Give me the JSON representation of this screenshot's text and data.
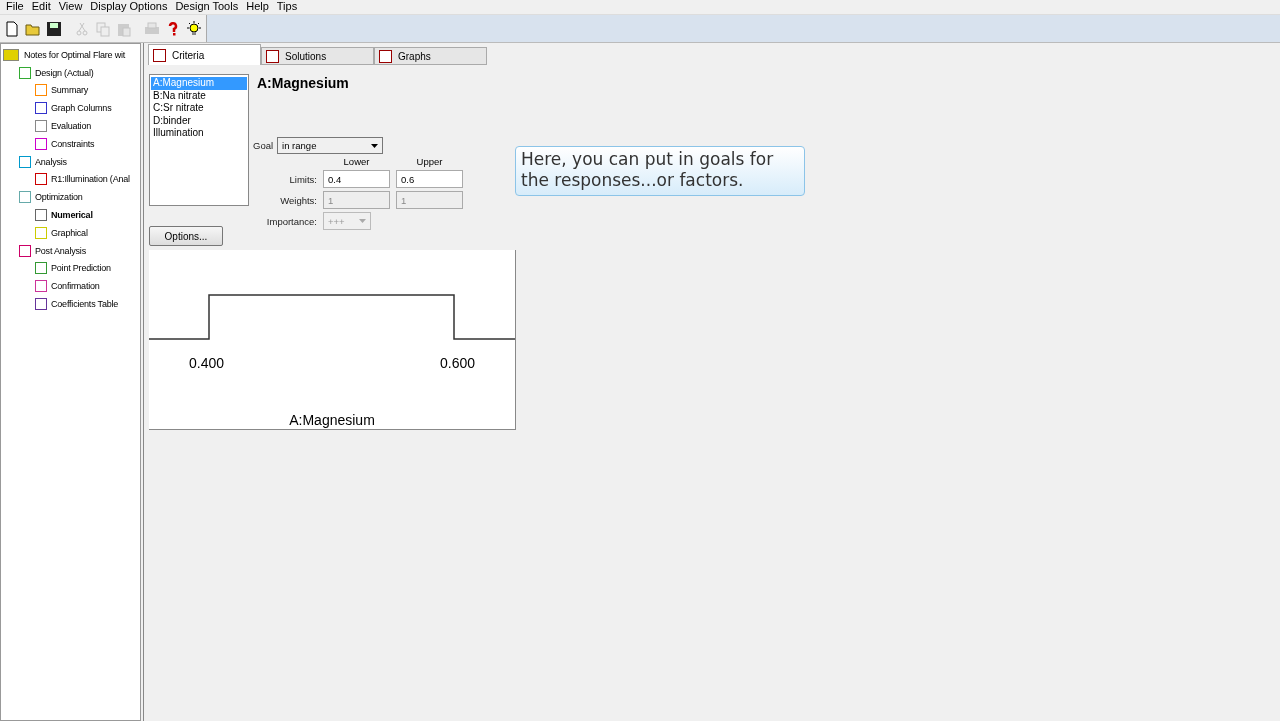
{
  "menu": [
    "File",
    "Edit",
    "View",
    "Display Options",
    "Design Tools",
    "Help",
    "Tips"
  ],
  "toolbar": [
    {
      "kind": "new",
      "disabled": false
    },
    {
      "kind": "open",
      "disabled": false
    },
    {
      "kind": "save",
      "disabled": false
    },
    {
      "kind": "cut",
      "disabled": true
    },
    {
      "kind": "copy",
      "disabled": true
    },
    {
      "kind": "paste",
      "disabled": true
    },
    {
      "kind": "print",
      "disabled": true
    },
    {
      "kind": "help",
      "disabled": false
    },
    {
      "kind": "tip",
      "disabled": false
    }
  ],
  "tree": {
    "label": "Notes for Optimal Flare wit",
    "selected": false,
    "children": [
      {
        "label": "Design (Actual)",
        "selected": false,
        "children": [
          {
            "label": "Summary",
            "selected": false
          },
          {
            "label": "Graph Columns",
            "selected": false
          },
          {
            "label": "Evaluation",
            "selected": false
          },
          {
            "label": "Constraints",
            "selected": false
          }
        ]
      },
      {
        "label": "Analysis",
        "selected": false,
        "children": [
          {
            "label": "R1:Illumination (Anal",
            "selected": false
          }
        ]
      },
      {
        "label": "Optimization",
        "selected": false,
        "children": [
          {
            "label": "Numerical",
            "selected": true
          },
          {
            "label": "Graphical",
            "selected": false
          }
        ]
      },
      {
        "label": "Post Analysis",
        "selected": false,
        "children": [
          {
            "label": "Point Prediction",
            "selected": false
          },
          {
            "label": "Confirmation",
            "selected": false
          },
          {
            "label": "Coefficients Table",
            "selected": false
          }
        ]
      }
    ]
  },
  "tabs": [
    {
      "label": "Criteria",
      "selected": true
    },
    {
      "label": "Solutions",
      "selected": false
    },
    {
      "label": "Graphs",
      "selected": false
    }
  ],
  "variables": [
    {
      "label": "A:Magnesium",
      "selected": true
    },
    {
      "label": "B:Na nitrate",
      "selected": false
    },
    {
      "label": "C:Sr nitrate",
      "selected": false
    },
    {
      "label": "D:binder",
      "selected": false
    },
    {
      "label": "Illumination",
      "selected": false
    }
  ],
  "options_button": "Options...",
  "heading": "A:Magnesium",
  "goal": {
    "label": "Goal",
    "value": "in range"
  },
  "lower_header": "Lower",
  "upper_header": "Upper",
  "limits": {
    "label": "Limits:",
    "lower": "0.4",
    "upper": "0.6",
    "disabled": false
  },
  "weights": {
    "label": "Weights:",
    "lower": "1",
    "upper": "1",
    "disabled": true
  },
  "importance": {
    "label": "Importance:",
    "value": "+++",
    "disabled": true
  },
  "plot": {
    "low_label": "0.400",
    "high_label": "0.600",
    "axis_title": "A:Magnesium"
  },
  "callout": "Here, you can put in goals for the responses...or factors."
}
